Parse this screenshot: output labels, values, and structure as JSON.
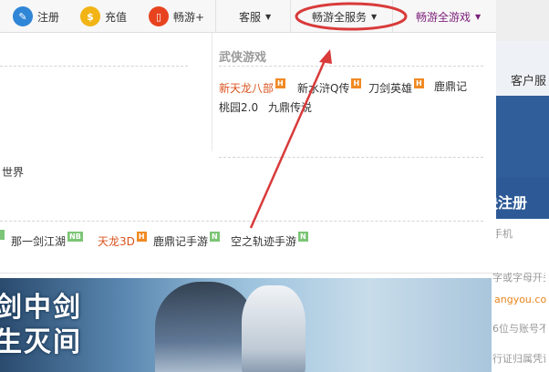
{
  "topbar": {
    "items": [
      {
        "label": "注册",
        "icon": "pencil-icon"
      },
      {
        "label": "充值",
        "icon": "coin-icon"
      },
      {
        "label": "畅游+",
        "icon": "phone-icon"
      }
    ],
    "service_label": "客服",
    "all_services_label": "畅游全服务",
    "all_games_label": "畅游全游戏"
  },
  "panel": {
    "left_partial": "世界",
    "section_title": "武侠游戏",
    "wuxia_row1": [
      {
        "text": "新天龙八部",
        "badge": "H",
        "hot": true
      },
      {
        "text": "新水浒Q传",
        "badge": "H",
        "hot": false
      },
      {
        "text": "刀剑英雄",
        "badge": "H",
        "hot": false
      },
      {
        "text": "鹿鼎记",
        "badge": "",
        "hot": false
      }
    ],
    "wuxia_row2": [
      {
        "text": "桃园2.0",
        "badge": "",
        "hot": false
      },
      {
        "text": "九鼎传说",
        "badge": "",
        "hot": false
      }
    ],
    "mobile_row": [
      {
        "text": "那一剑江湖",
        "badge": "NB",
        "hot": false
      },
      {
        "text": "天龙3D",
        "badge": "H",
        "hot": true
      },
      {
        "text": "鹿鼎记手游",
        "badge": "N",
        "hot": false
      },
      {
        "text": "空之轨迹手游",
        "badge": "N",
        "hot": false
      }
    ]
  },
  "right": {
    "service": "客户服",
    "register": "快注册",
    "line1": "手机",
    "line2": "字或字母开头",
    "line3": "angyou.com",
    "line4": "6位与账号不",
    "line5": "行证归属凭证"
  },
  "banner": {
    "line1": "剑中剑",
    "line2": "生灭间"
  },
  "colors": {
    "hot_text": "#d9531e",
    "games_purple": "#7b1f7a",
    "annotation_red": "#d93a3a"
  }
}
